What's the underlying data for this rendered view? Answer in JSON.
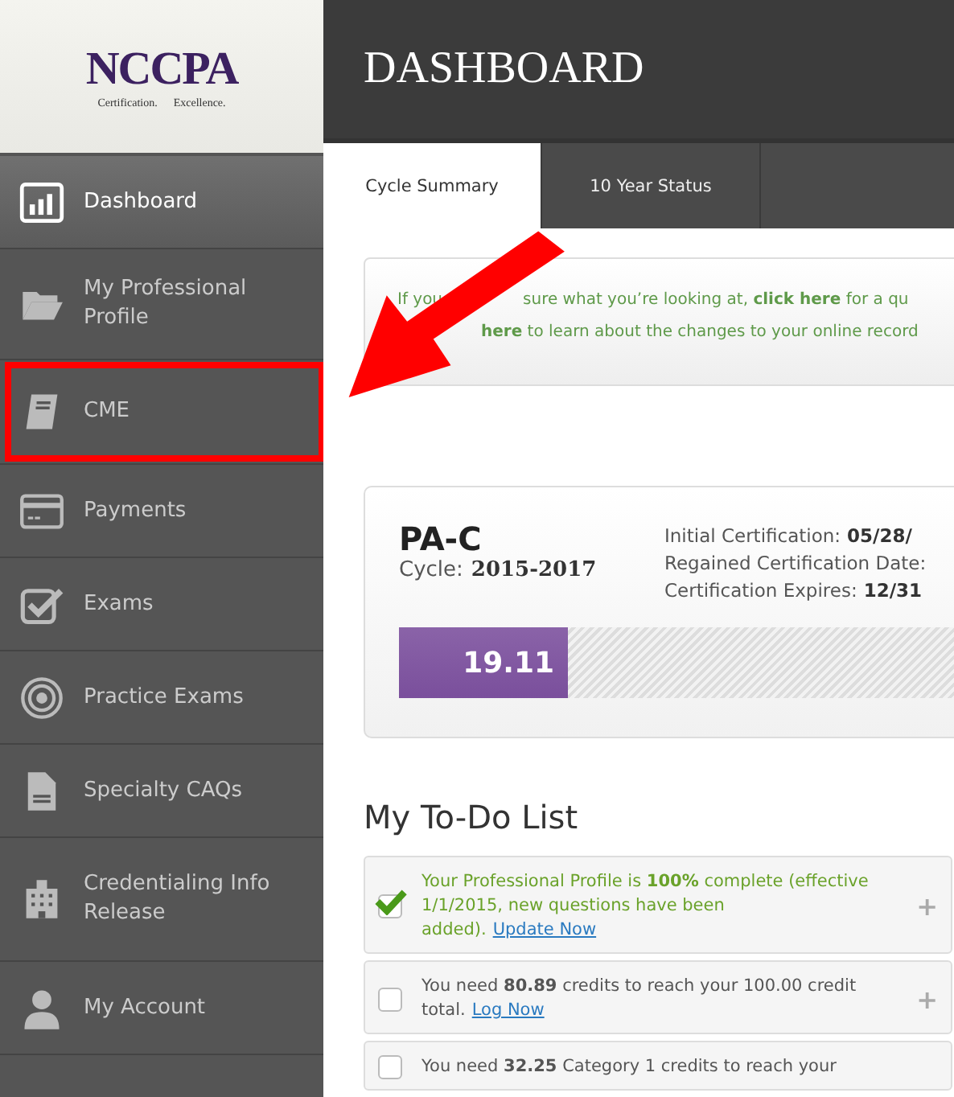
{
  "logo": {
    "name": "NCCPA",
    "tagline_left": "Certification.",
    "tagline_right": "Excellence."
  },
  "header": {
    "title": "DASHBOARD"
  },
  "sidebar": {
    "items": [
      {
        "label": "Dashboard",
        "selected": true,
        "highlighted": false
      },
      {
        "label": "My Professional Profile",
        "selected": false,
        "highlighted": false
      },
      {
        "label": "CME",
        "selected": false,
        "highlighted": true
      },
      {
        "label": "Payments",
        "selected": false,
        "highlighted": false
      },
      {
        "label": "Exams",
        "selected": false,
        "highlighted": false
      },
      {
        "label": "Practice Exams",
        "selected": false,
        "highlighted": false
      },
      {
        "label": "Specialty CAQs",
        "selected": false,
        "highlighted": false
      },
      {
        "label": "Credentialing Info Release",
        "selected": false,
        "highlighted": false
      },
      {
        "label": "My Account",
        "selected": false,
        "highlighted": false
      }
    ]
  },
  "tabs": [
    {
      "label": "Cycle Summary",
      "selected": true
    },
    {
      "label": "10 Year Status",
      "selected": false
    }
  ],
  "notice": {
    "line1_start": "If you",
    "line1_rest": "sure what you’re looking at, **click here** for a qu",
    "line2": "**here** to learn about the changes to your online record"
  },
  "certification": {
    "title": "PA-C",
    "cycle_label": "Cycle:",
    "cycle": "2015-2017",
    "details": [
      {
        "label": "Initial Certification:",
        "value": "05/28/"
      },
      {
        "label": "Regained Certification Date:"
      },
      {
        "label": "Certification Expires:",
        "value": "12/31"
      }
    ],
    "progress": {
      "level": 0.19,
      "reading": "19.11"
    }
  },
  "todo": {
    "title": "My To-Do List",
    "items": [
      {
        "checked": true,
        "text": "Your Professional Profile is **100%** complete (effective 1/1/2015, new questions have been added).",
        "link": "Update Now",
        "expand": "+"
      },
      {
        "checked": false,
        "text": "You need **80.89** credits to reach your 100.00 credit total.",
        "link": "Log Now",
        "expand": "+"
      },
      {
        "checked": false,
        "text": "You need **32.25** Category 1 credits to reach your"
      }
    ]
  }
}
